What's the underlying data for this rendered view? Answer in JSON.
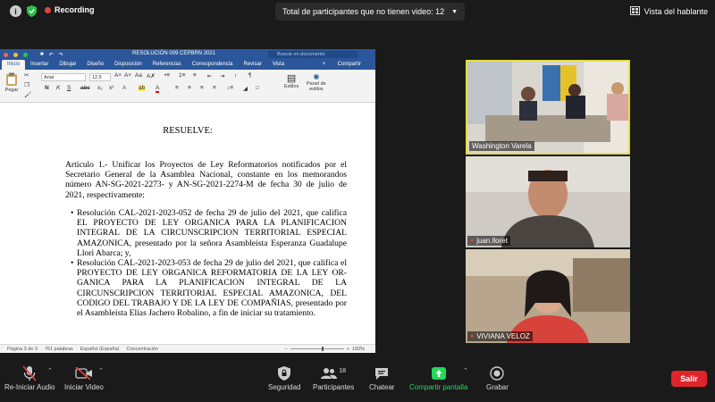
{
  "topbar": {
    "recording_label": "Recording",
    "view_filter_label": "Total de participantes que no tienen video: 12",
    "speaker_view_label": "Vista del hablante"
  },
  "word": {
    "document_title": "RESOLUCIÓN 009 CEPBRN 2021",
    "search_placeholder": "Buscar en documento",
    "tabs": [
      "Inicio",
      "Insertar",
      "Dibujar",
      "Diseño",
      "Disposición",
      "Referencias",
      "Correspondencia",
      "Revisar",
      "Vista"
    ],
    "share_label": "Compartir",
    "paste_label": "Pegar",
    "font_name": "Arial",
    "font_size": "12,5",
    "styles_label": "Estilos",
    "styles_pane_label_1": "Panel de",
    "styles_pane_label_2": "estilos",
    "status": {
      "page": "Página 3 de 3",
      "words": "761 palabras",
      "language": "Español (España)",
      "focus": "Concentración",
      "zoom": "160%"
    }
  },
  "document": {
    "heading": "RESUELVE:",
    "article": "Artículo 1.- Unificar los Proyectos de Ley Reformatorios notificados por el Secretario General de la Asamblea Nacional, constante en los memorandos número AN-SG-2021-2273- y AN-SG-2021-2274-M de fecha 30 de julio de 2021, respectivamente:",
    "bullet_1": "Resolución CAL-2021-2023-052 de fecha 29 de julio del 2021, que califica EL PROYECTO DE LEY ORGANICA PARA LA PLANIFICACION INTEGRAL DE LA CIRCUNSCRIPCION TERRITORIAL ESPECIAL AMAZONICA, presentado por la señora Asambleísta Esperanza Guadalupe Llori Abarca; y,",
    "bullet_2": "Resolución CAL-2021-2023-053 de fecha 29 de julio del 2021, que califica el PROYECTO DE LEY ORGANICA REFORMATORIA DE LA LEY OR-GANICA PARA LA PLANIFICACION INTEGRAL DE LA CIRCUNSCRIPCION TERRITORIAL ESPECIAL AMAZONICA, DEL CODIGO DEL TRABAJO Y DE LA LEY DE COMPAÑIAS, presentado por el Asambleísta Elías Jachero Robalino, a fin de iniciar su tratamiento."
  },
  "participants": [
    {
      "name": "Washington Varela",
      "active_speaker": true
    },
    {
      "name": "juan.lloret",
      "active_speaker": false
    },
    {
      "name": "VIVIANA VELOZ",
      "active_speaker": false
    }
  ],
  "toolbar": {
    "audio_label": "Re-Iniciar Audio",
    "video_label": "Iniciar Video",
    "security_label": "Seguridad",
    "participants_label": "Participantes",
    "participants_count": "18",
    "chat_label": "Chatear",
    "share_screen_label": "Compartir pantalla",
    "record_label": "Grabar",
    "leave_label": "Salir"
  },
  "colors": {
    "word_blue": "#2b579a",
    "active_speaker_border": "#e3df3f",
    "share_green": "#23d959",
    "leave_red": "#e0242b",
    "muted_red": "#e0463b"
  }
}
